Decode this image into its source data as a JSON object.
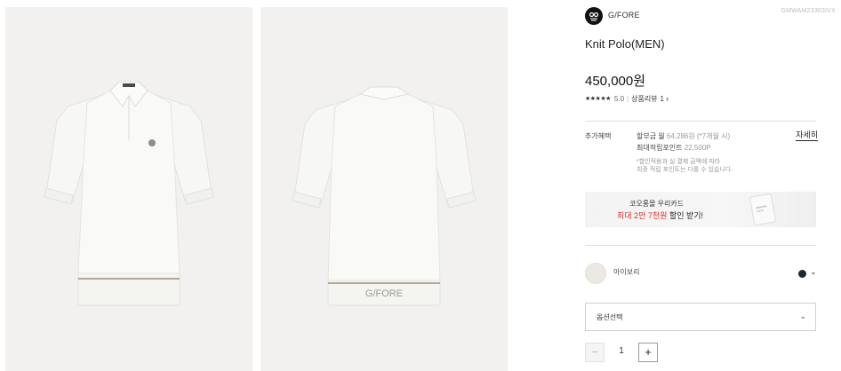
{
  "gallery": {
    "front_alt": "Knit polo front view",
    "back_alt": "Knit polo back view",
    "back_hem_text": "G/FORE"
  },
  "brand": {
    "name": "G/FORE",
    "code": "GMWAM23303IVX",
    "logo_icon": "gfore-skull-logo-icon"
  },
  "product": {
    "title": "Knit Polo(MEN)",
    "price": "450,000원"
  },
  "rating": {
    "stars": "★★★★★",
    "score": "5.0",
    "separator": "|",
    "review_label": "상품리뷰",
    "review_count": "1",
    "arrow": "›"
  },
  "benefits": {
    "label": "추가혜택",
    "installment_prefix": "할부금 월",
    "installment_value": "64,286원 (*7개월 시)",
    "points_prefix": "최대적립포인트",
    "points_value": "22,500P",
    "detail_link": "자세히",
    "note_line1": "*할인적용과 실 결제 금액에 따라",
    "note_line2": "최종 적립 포인트는 다를 수 있습니다."
  },
  "card_promo": {
    "line1": "코오롱몰 우리카드",
    "line2_red": "최대 2만 7천원",
    "line2_rest": " 할인 받기!"
  },
  "color": {
    "name": "아이보리",
    "swatch_color": "#ece9e2",
    "alt_color": "#1e2536",
    "chevron": "⌄"
  },
  "option": {
    "label": "옵션선택",
    "chevron": "⌄"
  },
  "quantity": {
    "minus": "−",
    "value": "1",
    "plus": "+"
  }
}
